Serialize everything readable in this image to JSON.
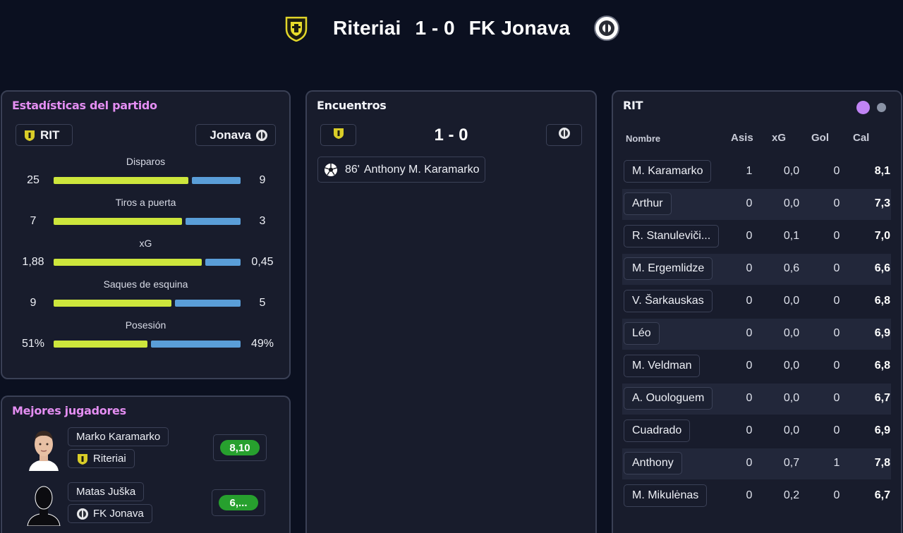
{
  "header": {
    "home_team": "Riteriai",
    "score": "1 - 0",
    "away_team": "FK Jonava",
    "home_crest_icon": "riteriai-crest-icon",
    "away_crest_icon": "jonava-crest-icon"
  },
  "stats": {
    "title": "Estadísticas del partido",
    "home_chip": "RIT",
    "away_chip": "Jonava",
    "rows": [
      {
        "label": "Disparos",
        "home": "25",
        "away": "9",
        "home_share": 0.735
      },
      {
        "label": "Tiros a puerta",
        "home": "7",
        "away": "3",
        "home_share": 0.7
      },
      {
        "label": "xG",
        "home": "1,88",
        "away": "0,45",
        "home_share": 0.807
      },
      {
        "label": "Saques de esquina",
        "home": "9",
        "away": "5",
        "home_share": 0.643
      },
      {
        "label": "Posesión",
        "home": "51%",
        "away": "49%",
        "home_share": 0.51
      }
    ],
    "colors": {
      "home": "#cde63c",
      "away": "#5a9ed8"
    }
  },
  "best_players": {
    "title": "Mejores jugadores",
    "players": [
      {
        "name": "Marko Karamarko",
        "club": "Riteriai",
        "rating": "8,10",
        "avatar": "player-photo"
      },
      {
        "name": "Matas Juška",
        "club": "FK Jonava",
        "rating": "6,...",
        "avatar": "silhouette-avatar"
      }
    ]
  },
  "events": {
    "title": "Encuentros",
    "score": "1 - 0",
    "items": [
      {
        "icon": "soccer-ball-icon",
        "minute": "86'",
        "player": "Anthony M. Karamarko"
      }
    ]
  },
  "lineup": {
    "title": "RIT",
    "columns": {
      "name": "Nombre",
      "asis": "Asis",
      "xg": "xG",
      "gol": "Gol",
      "cal": "Cal"
    },
    "rows": [
      {
        "name": "M. Karamarko",
        "asis": "1",
        "xg": "0,0",
        "gol": "0",
        "cal": "8,1"
      },
      {
        "name": "Arthur",
        "asis": "0",
        "xg": "0,0",
        "gol": "0",
        "cal": "7,3"
      },
      {
        "name": "R. Stanuleviči...",
        "asis": "0",
        "xg": "0,1",
        "gol": "0",
        "cal": "7,0"
      },
      {
        "name": "M. Ergemlidze",
        "asis": "0",
        "xg": "0,6",
        "gol": "0",
        "cal": "6,6"
      },
      {
        "name": "V. Šarkauskas",
        "asis": "0",
        "xg": "0,0",
        "gol": "0",
        "cal": "6,8"
      },
      {
        "name": "Léo",
        "asis": "0",
        "xg": "0,0",
        "gol": "0",
        "cal": "6,9"
      },
      {
        "name": "M. Veldman",
        "asis": "0",
        "xg": "0,0",
        "gol": "0",
        "cal": "6,8"
      },
      {
        "name": "A. Ouologuem",
        "asis": "0",
        "xg": "0,0",
        "gol": "0",
        "cal": "6,7"
      },
      {
        "name": "Cuadrado",
        "asis": "0",
        "xg": "0,0",
        "gol": "0",
        "cal": "6,9"
      },
      {
        "name": "Anthony",
        "asis": "0",
        "xg": "0,7",
        "gol": "1",
        "cal": "7,8"
      },
      {
        "name": "M. Mikulėnas",
        "asis": "0",
        "xg": "0,2",
        "gol": "0",
        "cal": "6,7"
      }
    ]
  }
}
